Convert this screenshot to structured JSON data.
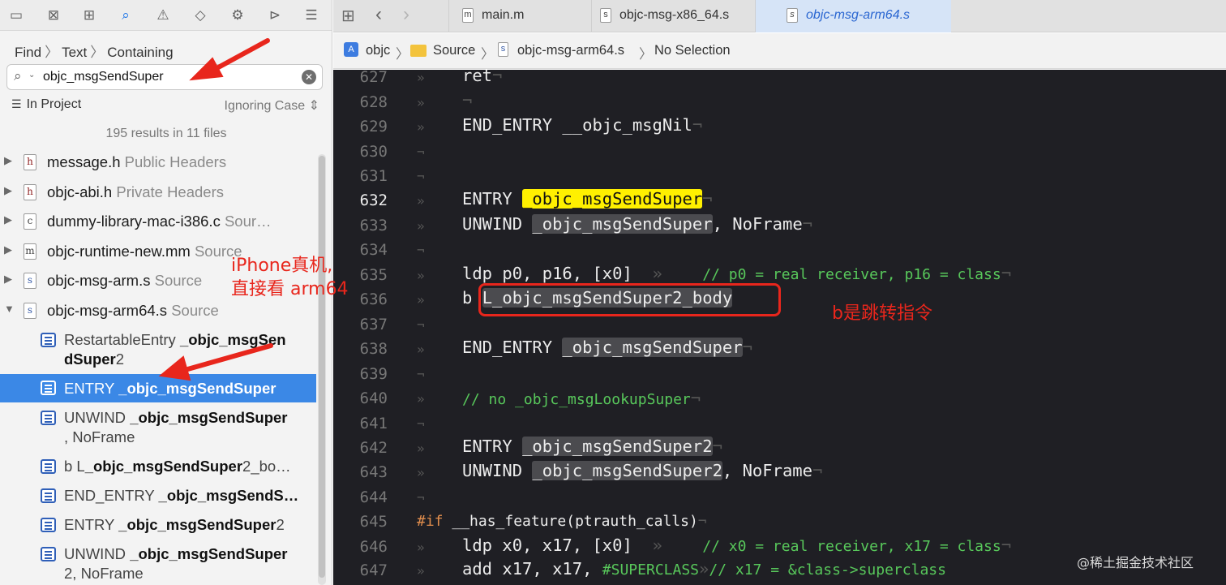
{
  "navigator": {
    "toolbar_icons": [
      "folder-icon",
      "source-control-icon",
      "symbol-icon",
      "find-icon",
      "issue-icon",
      "test-icon",
      "debug-icon",
      "breakpoint-icon",
      "report-icon"
    ],
    "breadcrumb": [
      "Find",
      "Text",
      "Containing"
    ],
    "search": {
      "value": "objc_msgSendSuper",
      "placeholder": ""
    },
    "scope": "In Project",
    "case": "Ignoring Case",
    "summary": "195 results in 11 files",
    "files": [
      {
        "icon": "h",
        "name": "message.h",
        "group": "Public Headers"
      },
      {
        "icon": "h",
        "name": "objc-abi.h",
        "group": "Private Headers"
      },
      {
        "icon": "c",
        "name": "dummy-library-mac-i386.c",
        "group": "Sour…"
      },
      {
        "icon": "m",
        "name": "objc-runtime-new.mm",
        "group": "Source"
      },
      {
        "icon": "s",
        "name": "objc-msg-arm.s",
        "group": "Source"
      },
      {
        "icon": "s",
        "name": "objc-msg-arm64.s",
        "group": "Source"
      }
    ],
    "matches": [
      {
        "pre": "RestartableEntry ",
        "bold": "_objc_msgSen",
        "line2_bold": "dSuper",
        "post": "2"
      },
      {
        "pre": "ENTRY ",
        "bold": "_objc_msgSendSuper",
        "post": ""
      },
      {
        "pre": "UNWIND ",
        "bold": "_objc_msgSendSuper",
        "line2_post": ", NoFrame"
      },
      {
        "pre": "b L",
        "bold": "_objc_msgSendSuper",
        "post": "2_bo…"
      },
      {
        "pre": "END_ENTRY ",
        "bold": "_objc_msgSendS…",
        "post": ""
      },
      {
        "pre": "ENTRY ",
        "bold": "_objc_msgSendSuper",
        "post": "2"
      },
      {
        "pre": "UNWIND ",
        "bold": "_objc_msgSendSuper",
        "line2_post": "2, NoFrame"
      }
    ]
  },
  "tabs": [
    "main.m",
    "objc-msg-x86_64.s",
    "objc-msg-arm64.s"
  ],
  "jumpbar": [
    "objc",
    "Source",
    "objc-msg-arm64.s",
    "No Selection"
  ],
  "editor": {
    "current_line": "632",
    "lines": [
      {
        "n": "627",
        "code": "ret"
      },
      {
        "n": "628",
        "code": ""
      },
      {
        "n": "629",
        "code": "END_ENTRY __objc_msgNil"
      },
      {
        "n": "630",
        "code": ""
      },
      {
        "n": "631",
        "code": ""
      },
      {
        "n": "632",
        "kw": "ENTRY ",
        "sym": "_objc_msgSendSuper"
      },
      {
        "n": "633",
        "kw": "UNWIND ",
        "sym": "_objc_msgSendSuper",
        "tail": ", NoFrame"
      },
      {
        "n": "634",
        "code": ""
      },
      {
        "n": "635",
        "code": "ldp p0, p16, [x0]",
        "comment": "// p0 = real receiver, p16 = class"
      },
      {
        "n": "636",
        "kw": "b ",
        "sym": "L_objc_msgSendSuper2_body"
      },
      {
        "n": "637",
        "code": ""
      },
      {
        "n": "638",
        "kw": "END_ENTRY ",
        "sym": "_objc_msgSendSuper"
      },
      {
        "n": "639",
        "code": ""
      },
      {
        "n": "640",
        "comment": "// no _objc_msgLookupSuper"
      },
      {
        "n": "641",
        "code": ""
      },
      {
        "n": "642",
        "kw": "ENTRY ",
        "sym": "_objc_msgSendSuper2"
      },
      {
        "n": "643",
        "kw": "UNWIND ",
        "sym": "_objc_msgSendSuper2",
        "tail": ", NoFrame"
      },
      {
        "n": "644",
        "code": ""
      },
      {
        "n": "645",
        "pp": "#if",
        "tail": " __has_feature(ptrauth_calls)"
      },
      {
        "n": "646",
        "code": "ldp x0, x17, [x0]",
        "comment": "// x0 = real receiver, x17 = class"
      },
      {
        "n": "647",
        "code": "add x17, x17, ",
        "const": "#SUPERCLASS",
        "comment": "// x17 = &class->superclass"
      }
    ]
  },
  "annotations": {
    "iphone_line1": "iPhone真机,",
    "iphone_line2": "直接看 arm64",
    "b_jump": "b是跳转指令"
  },
  "watermark": "@稀土掘金技术社区",
  "colors": {
    "accent": "#3b88e6",
    "annotation": "#e8261c",
    "symbol_highlight": "#fff000",
    "comment": "#58c85b"
  }
}
